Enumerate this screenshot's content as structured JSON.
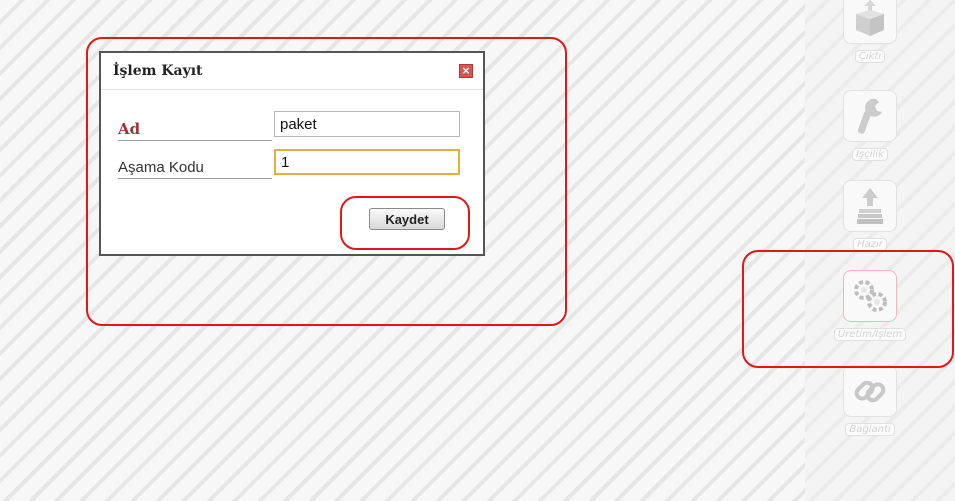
{
  "dialog": {
    "title": "İşlem Kayıt",
    "close_symbol": "×",
    "fields": [
      {
        "label": "Ad",
        "value": "paket"
      },
      {
        "label": "Aşama Kodu",
        "value": "1"
      }
    ],
    "save_label": "Kaydet"
  },
  "toolbar": {
    "items": [
      {
        "label": "Çıktı",
        "icon": "package-icon"
      },
      {
        "label": "İşçilik",
        "icon": "wrench-icon"
      },
      {
        "label": "Hazır",
        "icon": "upload-stack-icon"
      },
      {
        "label": "Üretim/İşlem",
        "icon": "gears-icon",
        "selected": true
      },
      {
        "label": "Bağlantı",
        "icon": "link-icon"
      }
    ]
  },
  "colors": {
    "highlight": "#e01818",
    "label_accent": "#9b3535",
    "focus": "#e0b040"
  }
}
